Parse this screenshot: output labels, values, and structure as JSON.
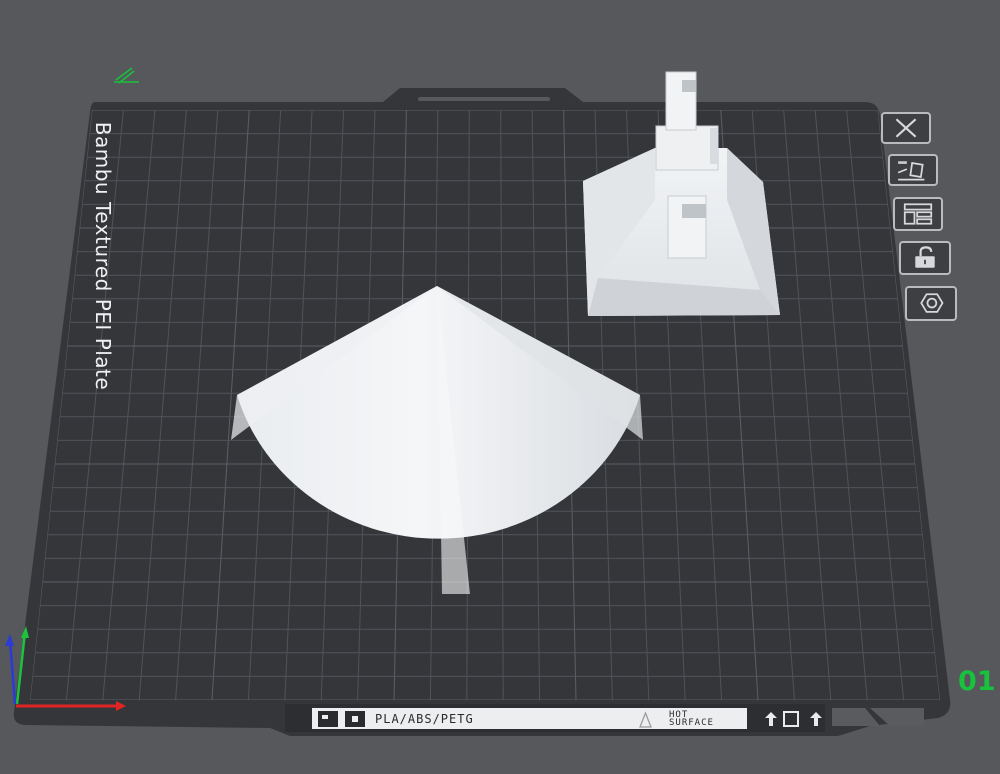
{
  "plate": {
    "label": "Bambu Textured PEI Plate",
    "number": "01",
    "material_text": "PLA/ABS/PETG",
    "hot_surface_line1": "HOT",
    "hot_surface_line2": "SURFACE"
  },
  "plate_toolbar": {
    "buttons": [
      {
        "icon": "close-icon"
      },
      {
        "icon": "auto-orient-icon"
      },
      {
        "icon": "arrange-icon"
      },
      {
        "icon": "lock-icon"
      },
      {
        "icon": "settings-icon"
      }
    ]
  },
  "colors": {
    "background": "#56585c",
    "plate": "#3a3b3f",
    "grid": "#53565b",
    "model": "#e7ebee",
    "accent_green": "#18c23d",
    "axis_x": "#e02424",
    "axis_y": "#1cc43c",
    "axis_z": "#2a3bd8"
  }
}
